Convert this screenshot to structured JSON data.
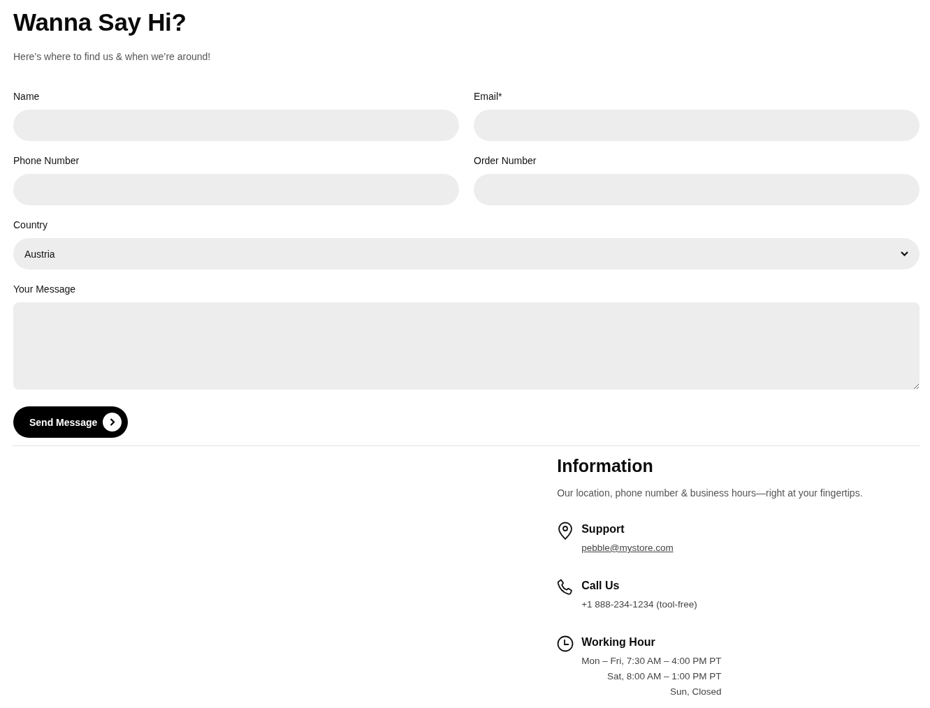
{
  "header": {
    "title": "Wanna Say Hi?",
    "subtitle": "Here’s where to find us & when we’re around!"
  },
  "form": {
    "fields": [
      {
        "kind": "text",
        "label": "Name"
      },
      {
        "kind": "text",
        "label": "Email*"
      },
      {
        "kind": "text",
        "label": "Phone Number"
      },
      {
        "kind": "text",
        "label": "Order Number"
      },
      {
        "kind": "select",
        "label": "Country",
        "value": "Austria"
      },
      {
        "kind": "textarea",
        "label": "Your Message"
      }
    ],
    "submit": {
      "label": "Send Message"
    }
  },
  "information": {
    "title": "Information",
    "subtitle": "Our location, phone number & business hours—right at your fingertips.",
    "items": [
      {
        "kind": "email",
        "title": "Support",
        "lines": [
          {
            "kind": "link",
            "text": "pebble@mystore.com"
          }
        ]
      },
      {
        "kind": "phone",
        "title": "Call Us",
        "lines": [
          {
            "kind": "text",
            "text": "+1 888-234-1234 (tool-free)"
          }
        ]
      },
      {
        "kind": "hours",
        "title": "Working Hour",
        "lines": [
          {
            "kind": "text",
            "text": "Mon – Fri, 7:30 AM – 4:00 PM PT"
          },
          {
            "kind": "text",
            "text": "Sat, 8:00 AM – 1:00 PM PT"
          },
          {
            "kind": "text",
            "text": "Sun, Closed"
          }
        ]
      }
    ]
  }
}
